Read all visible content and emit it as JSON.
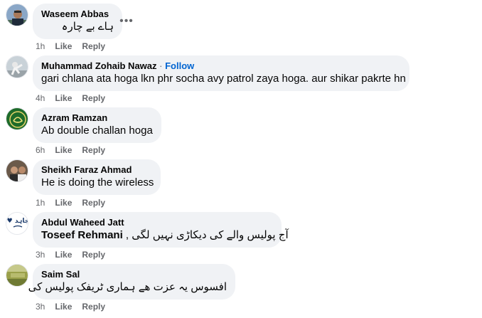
{
  "comments": [
    {
      "author": "Waseem Abbas",
      "text": "ہاے بے چارہ",
      "time": "1h",
      "like": "Like",
      "reply": "Reply",
      "more": "•••"
    },
    {
      "author": "Muhammad Zohaib Nawaz",
      "separator": " · ",
      "follow": "Follow",
      "text": "gari chlana ata hoga lkn phr socha avy patrol zaya hoga. aur shikar pakrte hn",
      "time": "4h",
      "like": "Like",
      "reply": "Reply"
    },
    {
      "author": "Azram Ramzan",
      "text": "Ab double challan hoga",
      "time": "6h",
      "like": "Like",
      "reply": "Reply"
    },
    {
      "author": "Sheikh Faraz Ahmad",
      "text": "He is doing the wireless",
      "time": "1h",
      "like": "Like",
      "reply": "Reply"
    },
    {
      "author": "Abdul Waheed Jatt",
      "mention": "Toseef Rehmani",
      "text": "آج پولیس والے کی دیکاڑی نہیں لگی ,",
      "time": "3h",
      "like": "Like",
      "reply": "Reply",
      "avatar_text": "I ♥ مجاہد"
    },
    {
      "author": "Saim Sal",
      "text": "افسوس یہ عزت ھے ہماری ٹریفک پولیس کی",
      "time": "3h",
      "like": "Like",
      "reply": "Reply"
    }
  ],
  "colors": {
    "bubble": "#f0f2f5",
    "meta": "#65676b",
    "follow": "#0064d1"
  }
}
